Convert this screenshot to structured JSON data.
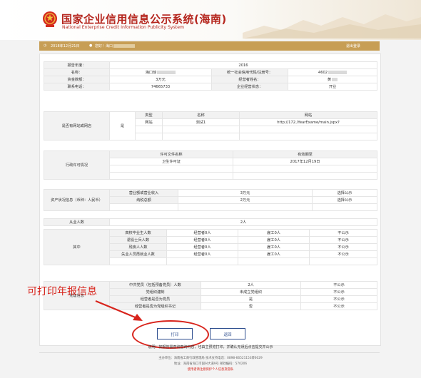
{
  "header": {
    "title": "国家企业信用信息公示系统(海南)",
    "subtitle": "National Enterprise Credit Information Publicity System"
  },
  "toolbar": {
    "date": "2018年12月21日",
    "greeting": "您好！海口",
    "logout": "退出登录"
  },
  "basic": {
    "report_year_label": "报告年度：",
    "report_year": "2016",
    "name_label": "名称：",
    "name_value": "海口琼",
    "credit_code_label": "统一社会信用代码/注册号：",
    "credit_code_value": "4602",
    "capital_label": "资金数额：",
    "capital_value": "3万元",
    "operator_label": "经营者姓名：",
    "operator_value": "黄",
    "phone_label": "联系电话：",
    "phone_value": "74665733",
    "status_label": "企业经营状态：",
    "status_value": "开业"
  },
  "website": {
    "row_label": "是否有网站或网店",
    "has_site": "是",
    "headers": [
      "类型",
      "名称",
      "网站"
    ],
    "rows": [
      [
        "网站",
        "测试1",
        "http://172./YearExame/main.jspx?"
      ]
    ]
  },
  "license": {
    "row_label": "行政许可情况",
    "headers": [
      "许可文件名称",
      "有效期至"
    ],
    "rows": [
      [
        "卫生许可证",
        "2017年12月19日"
      ]
    ]
  },
  "assets": {
    "row_label": "资产状况信息（币种：人民币）",
    "rows": [
      [
        "营业额或营业收入",
        "3万元",
        "选择公示"
      ],
      [
        "纳税总额",
        "2万元",
        "选择公示"
      ]
    ]
  },
  "employees": {
    "label": "从业人数",
    "value": "2人"
  },
  "among": {
    "row_label": "其中",
    "rows": [
      [
        "高校毕业生人数",
        "经营者0人",
        "雇工0人",
        "不公示"
      ],
      [
        "退役士兵人数",
        "经营者0人",
        "雇工0人",
        "不公示"
      ],
      [
        "残疾人人数",
        "经营者0人",
        "雇工0人",
        "不公示"
      ],
      [
        "失业人员再就业人数",
        "经营者0人",
        "雇工0人",
        "不公示"
      ]
    ]
  },
  "party": {
    "row_label": "党建信息",
    "rows": [
      [
        "中共党员（包括预备党员）人数",
        "2人",
        "不公示"
      ],
      [
        "党组织建制",
        "未成立党组织",
        "不公示"
      ],
      [
        "经营者是否为党员",
        "是",
        "不公示"
      ],
      [
        "经营者是否为党组织书记",
        "否",
        "不公示"
      ]
    ]
  },
  "buttons": {
    "print": "打印",
    "back": "返回"
  },
  "annotation": "可打印年报信息",
  "note": "说明：如报告需查询查询内容，也由主预览打印，并确认无误后点击提交并公示",
  "footer": {
    "line1": "主办单位：海南省工商行政管理局  技术支持电话：0898-66521153转6029",
    "line2": "地址：海南省海口市国兴大道9号  邮政编码：570206",
    "line3": "使用者请注意保护个人信息及隐私"
  },
  "colors": {
    "brand_red": "#b5261e",
    "toolbar": "#c79e55",
    "annotation": "#d8231b"
  }
}
